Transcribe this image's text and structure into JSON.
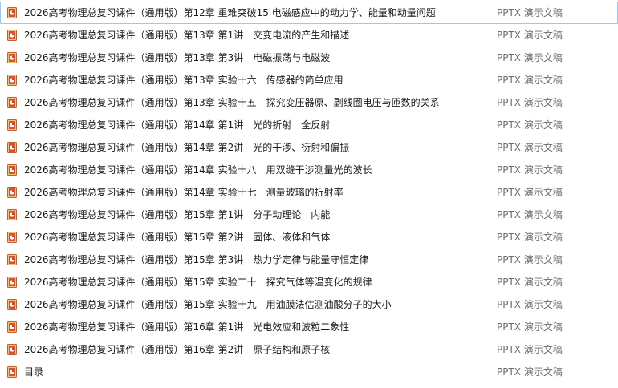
{
  "file_list": {
    "rows": [
      {
        "name": "2026高考物理总复习课件（通用版）第12章 重难突破15 电磁感应中的动力学、能量和动量问题",
        "type": "PPTX 演示文稿",
        "icon": "pptx-file-icon",
        "selected": true
      },
      {
        "name": "2026高考物理总复习课件（通用版）第13章 第1讲　交变电流的产生和描述",
        "type": "PPTX 演示文稿",
        "icon": "pptx-file-icon"
      },
      {
        "name": "2026高考物理总复习课件（通用版）第13章 第3讲　电磁振荡与电磁波",
        "type": "PPTX 演示文稿",
        "icon": "pptx-file-icon"
      },
      {
        "name": "2026高考物理总复习课件（通用版）第13章 实验十六　传感器的简单应用",
        "type": "PPTX 演示文稿",
        "icon": "pptx-file-icon"
      },
      {
        "name": "2026高考物理总复习课件（通用版）第13章 实验十五　探究变压器原、副线圈电压与匝数的关系",
        "type": "PPTX 演示文稿",
        "icon": "pptx-file-icon"
      },
      {
        "name": "2026高考物理总复习课件（通用版）第14章 第1讲　光的折射　全反射",
        "type": "PPTX 演示文稿",
        "icon": "pptx-file-icon"
      },
      {
        "name": "2026高考物理总复习课件（通用版）第14章 第2讲　光的干涉、衍射和偏振",
        "type": "PPTX 演示文稿",
        "icon": "pptx-file-icon"
      },
      {
        "name": "2026高考物理总复习课件（通用版）第14章 实验十八　用双缝干涉测量光的波长",
        "type": "PPTX 演示文稿",
        "icon": "pptx-file-icon"
      },
      {
        "name": "2026高考物理总复习课件（通用版）第14章 实验十七　测量玻璃的折射率",
        "type": "PPTX 演示文稿",
        "icon": "pptx-file-icon"
      },
      {
        "name": "2026高考物理总复习课件（通用版）第15章 第1讲　分子动理论　内能",
        "type": "PPTX 演示文稿",
        "icon": "pptx-file-icon"
      },
      {
        "name": "2026高考物理总复习课件（通用版）第15章 第2讲　固体、液体和气体",
        "type": "PPTX 演示文稿",
        "icon": "pptx-file-icon"
      },
      {
        "name": "2026高考物理总复习课件（通用版）第15章 第3讲　热力学定律与能量守恒定律",
        "type": "PPTX 演示文稿",
        "icon": "pptx-file-icon"
      },
      {
        "name": "2026高考物理总复习课件（通用版）第15章 实验二十　探究气体等温变化的规律",
        "type": "PPTX 演示文稿",
        "icon": "pptx-file-icon"
      },
      {
        "name": "2026高考物理总复习课件（通用版）第15章 实验十九　用油膜法估测油酸分子的大小",
        "type": "PPTX 演示文稿",
        "icon": "pptx-file-icon"
      },
      {
        "name": "2026高考物理总复习课件（通用版）第16章 第1讲　光电效应和波粒二象性",
        "type": "PPTX 演示文稿",
        "icon": "pptx-file-icon"
      },
      {
        "name": "2026高考物理总复习课件（通用版）第16章 第2讲　原子结构和原子核",
        "type": "PPTX 演示文稿",
        "icon": "pptx-file-icon"
      },
      {
        "name": "目录",
        "type": "PPTX 演示文稿",
        "icon": "pptx-file-icon"
      }
    ]
  },
  "colors": {
    "icon_orange": "#d35230",
    "icon_dark": "#b7472a",
    "selection_border": "#99c9ef",
    "type_text": "#6d6d6d"
  }
}
